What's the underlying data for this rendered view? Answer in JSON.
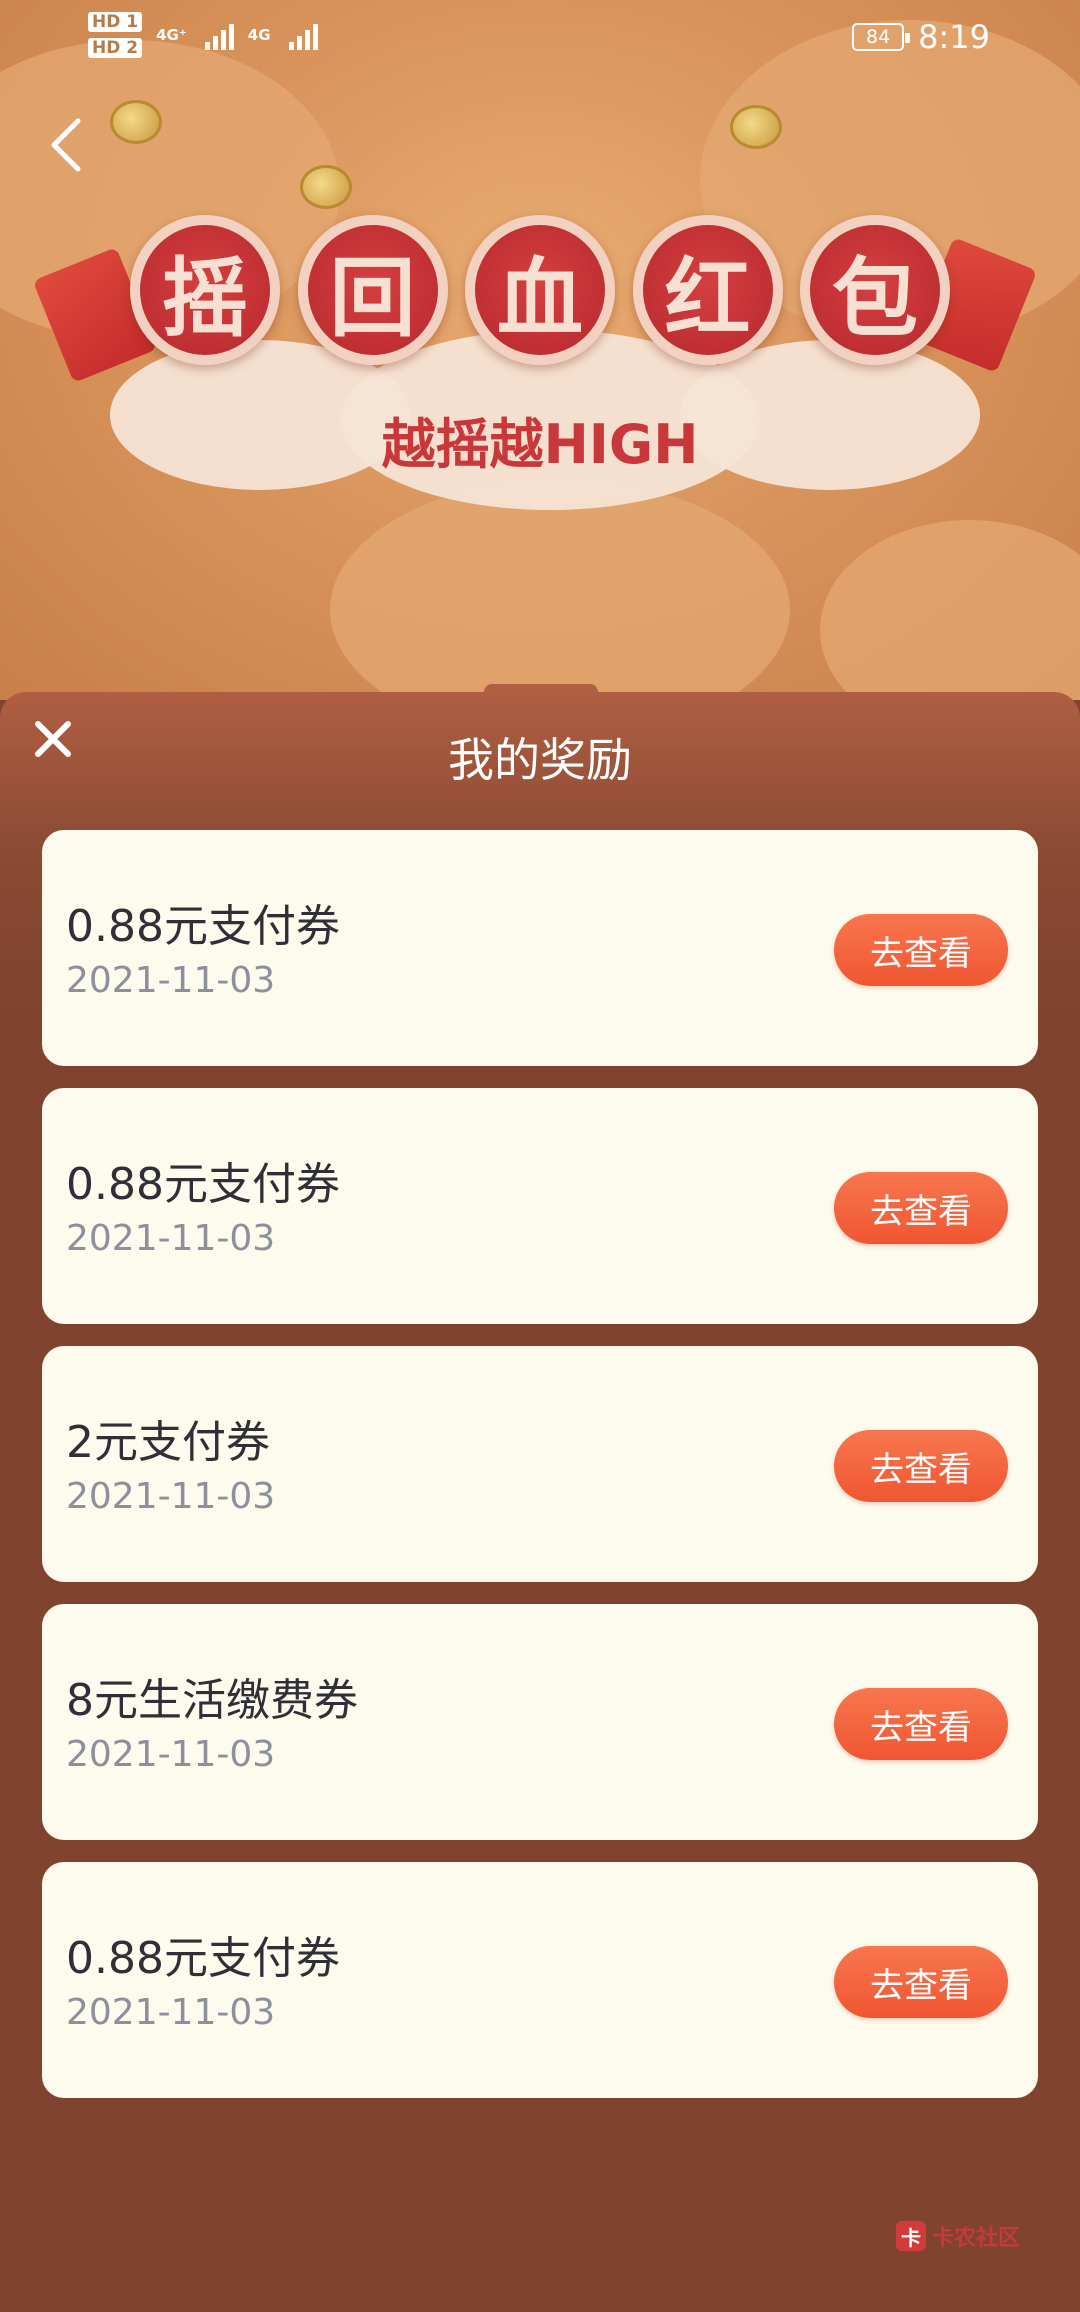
{
  "status_bar": {
    "sim1": "HD 1",
    "sim2": "HD 2",
    "net1": "4G⁺",
    "net2": "4G",
    "battery": "84",
    "time": "8:19"
  },
  "banner": {
    "title_chars": [
      "摇",
      "回",
      "血",
      "红",
      "包"
    ],
    "subtitle": "越摇越HIGH"
  },
  "sheet": {
    "title": "我的奖励"
  },
  "rewards": [
    {
      "name": "0.88元支付券",
      "date": "2021-11-03",
      "action": "去查看"
    },
    {
      "name": "0.88元支付券",
      "date": "2021-11-03",
      "action": "去查看"
    },
    {
      "name": "2元支付券",
      "date": "2021-11-03",
      "action": "去查看"
    },
    {
      "name": "8元生活缴费券",
      "date": "2021-11-03",
      "action": "去查看"
    },
    {
      "name": "0.88元支付券",
      "date": "2021-11-03",
      "action": "去查看"
    }
  ],
  "watermark": {
    "logo": "卡",
    "text": "卡农社区"
  },
  "icons": {
    "back": "chevron-left-icon",
    "close": "close-icon"
  },
  "colors": {
    "accent": "#ef5632",
    "sheet_bg": "#7f4330",
    "card_bg": "#fdfbed"
  }
}
